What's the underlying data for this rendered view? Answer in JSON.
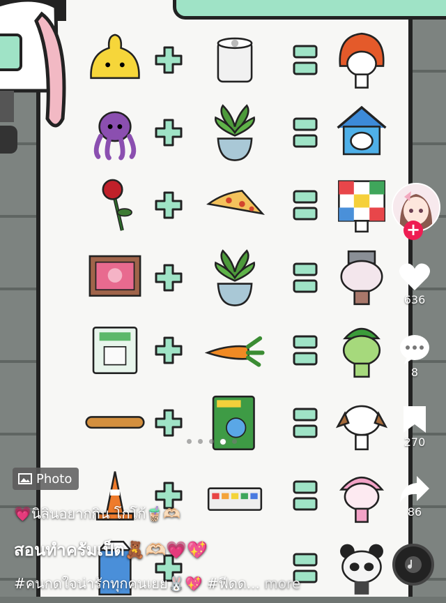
{
  "post": {
    "type_badge": "Photo",
    "caption_line1": "💗นิลินอยากกิน โกโก้🧋🫶🏻",
    "caption_line2": "สอนทำครัมเป็ต🧸🫶🏻💗💖",
    "caption_line3": "#คนกดใจน่ารักทุกคนเยย🐰💖 #ฟีดด...",
    "more_label": "more"
  },
  "actions": {
    "likes": "636",
    "comments": "8",
    "bookmarks": "270",
    "shares": "86"
  },
  "carousel": {
    "total": 5,
    "active_index": 3
  },
  "recipes": [
    {
      "a": "yellow-blob",
      "b": "toilet-paper",
      "r": "orange-hood-character"
    },
    {
      "a": "purple-octopus",
      "b": "potted-plant",
      "r": "blue-house-character"
    },
    {
      "a": "red-rose",
      "b": "pizza-slice",
      "r": "checkered-box-character"
    },
    {
      "a": "picture-frame",
      "b": "potted-plant",
      "r": "pot-hat-character"
    },
    {
      "a": "tofu-pack",
      "b": "carrot",
      "r": "green-leaf-character"
    },
    {
      "a": "baguette",
      "b": "band-book",
      "r": "dog-ear-character"
    },
    {
      "a": "traffic-cone",
      "b": "paint-palette",
      "r": "sprinkle-hat-character"
    },
    {
      "a": "milk-carton",
      "b": "",
      "r": "panda-character"
    }
  ],
  "colors": {
    "accent": "#ee1d52",
    "symbol_green": "#9fe3c6"
  }
}
